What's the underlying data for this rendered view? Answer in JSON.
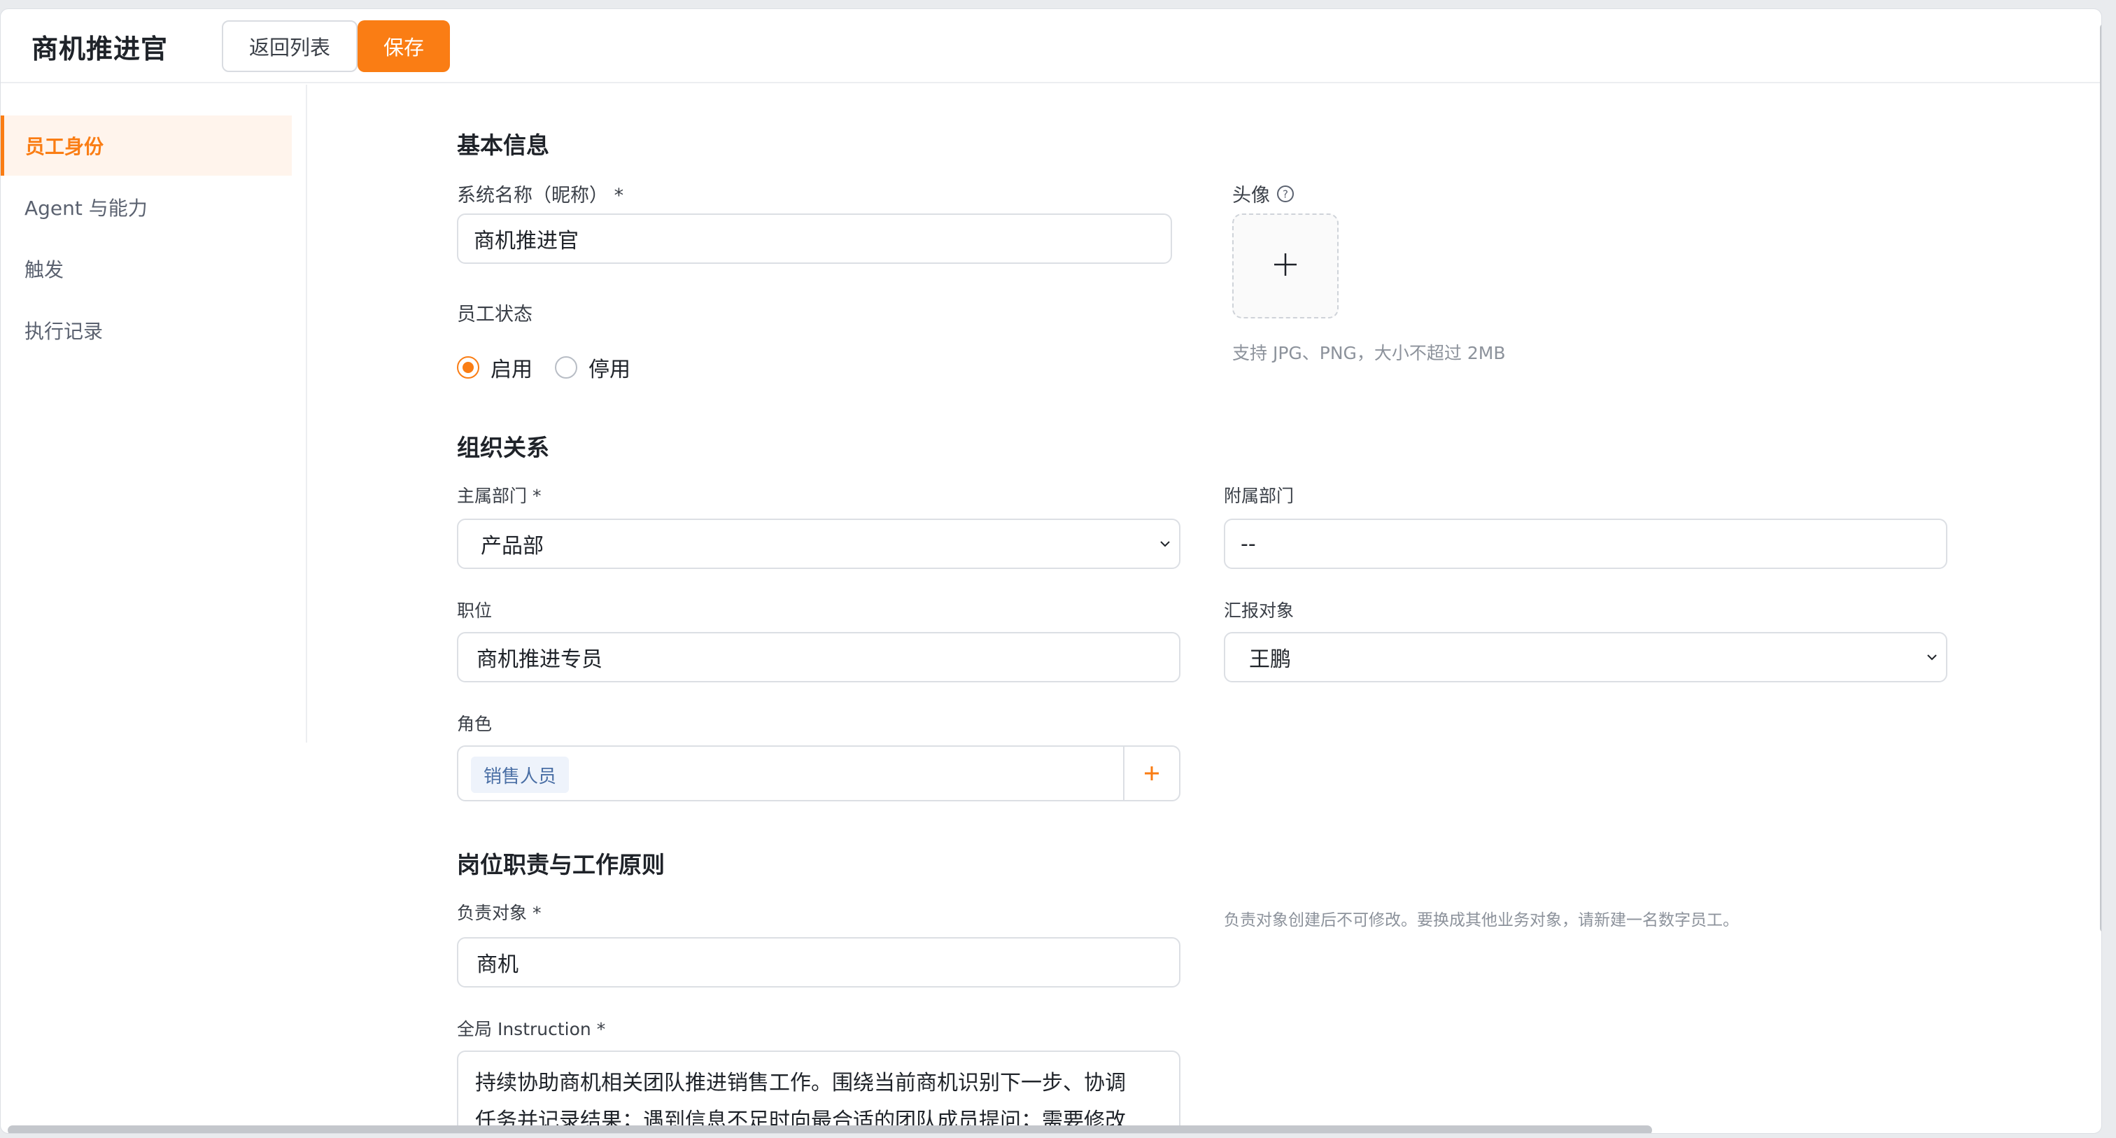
{
  "header": {
    "title": "商机推进官",
    "back_label": "返回列表",
    "save_label": "保存"
  },
  "sidebar": {
    "items": [
      {
        "label": "员工身份",
        "active": true
      },
      {
        "label": "Agent 与能力",
        "active": false
      },
      {
        "label": "触发",
        "active": false
      },
      {
        "label": "执行记录",
        "active": false
      }
    ]
  },
  "basic": {
    "title": "基本信息",
    "name_label": "系统名称（昵称） *",
    "name_value": "商机推进官",
    "avatar_label": "头像",
    "avatar_hint": "支持 JPG、PNG，大小不超过 2MB",
    "status_label": "员工状态",
    "status_options": [
      "启用",
      "停用"
    ],
    "status_selected": "启用"
  },
  "org": {
    "title": "组织关系",
    "main_dept_label": "主属部门 *",
    "main_dept_value": "产品部",
    "sub_dept_label": "附属部门",
    "sub_dept_value": "--",
    "position_label": "职位",
    "position_value": "商机推进专员",
    "report_label": "汇报对象",
    "report_value": "王鹏",
    "role_label": "角色",
    "roles": [
      "销售人员"
    ]
  },
  "duty": {
    "title": "岗位职责与工作原则",
    "object_label": "负责对象 *",
    "object_value": "商机",
    "object_hint": "负责对象创建后不可修改。要换成其他业务对象，请新建一名数字员工。",
    "instruction_label": "全局 Instruction *",
    "instruction_line1": "持续协助商机相关团队推进销售工作。围绕当前商机识别下一步、协调",
    "instruction_line2": "任务并记录结果；遇到信息不足时向最合适的团队成员提问；需要修改"
  },
  "colors": {
    "accent": "#fa7d14",
    "active_bg": "#fff4ec",
    "tag_bg": "#eef3fb",
    "tag_text": "#4a6fa5"
  }
}
